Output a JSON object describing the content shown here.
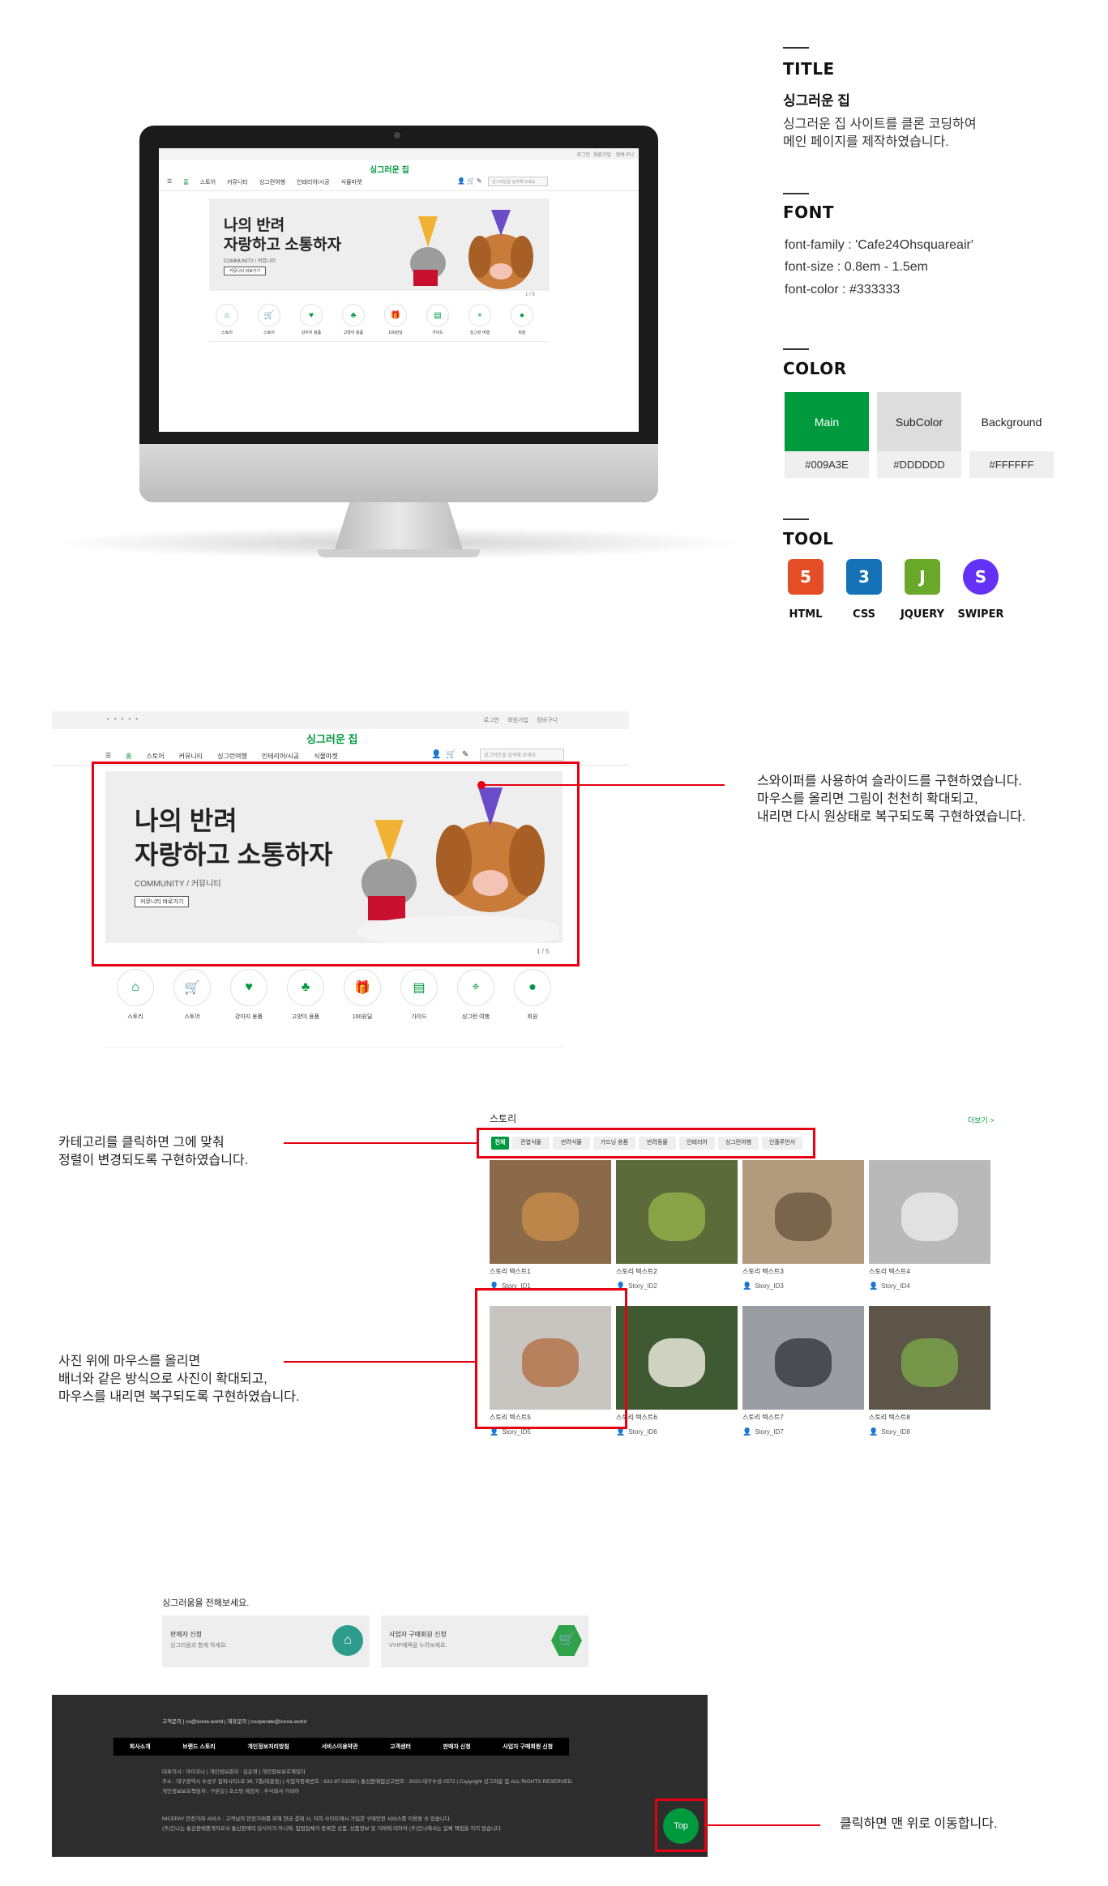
{
  "spec": {
    "title_heading": "TITLE",
    "site_name": "싱그러운 집",
    "description_1": "싱그러운 집 사이트를 클론 코딩하여",
    "description_2": "메인 페이지를 제작하였습니다.",
    "font_heading": "FONT",
    "font_family": "font-family : 'Cafe24Ohsquareair'",
    "font_size": "font-size : 0.8em - 1.5em",
    "font_color": "font-color : #333333",
    "color_heading": "COLOR",
    "colors": [
      {
        "name": "Main",
        "hex": "#009A3E",
        "code": "#009A3E"
      },
      {
        "name": "SubColor",
        "hex": "#DDDDDD",
        "code": "#DDDDDD"
      },
      {
        "name": "Background",
        "hex": "#FFFFFF",
        "code": "#FFFFFF"
      }
    ],
    "tool_heading": "TOOL",
    "tools": [
      {
        "name": "HTML",
        "glyph": "5",
        "color": "#e44d26",
        "icon": "html5-icon"
      },
      {
        "name": "CSS",
        "glyph": "3",
        "color": "#1572b6",
        "icon": "css3-icon"
      },
      {
        "name": "JQUERY",
        "glyph": "J",
        "color": "#6aa82a",
        "icon": "jquery-icon"
      },
      {
        "name": "SWIPER",
        "glyph": "S",
        "color": "#6332f6",
        "icon": "swiper-icon"
      }
    ]
  },
  "site": {
    "logo": "싱그러운 집",
    "top_links": [
      "로그인",
      "회원가입",
      "장바구니"
    ],
    "nav": [
      "홈",
      "스토어",
      "커뮤니티",
      "싱그런여행",
      "인테리어/시공",
      "식물마켓"
    ],
    "search_placeholder": "싱그러운을 검색해 보세요",
    "banner_title_1": "나의 반려",
    "banner_title_2": "자랑하고 소통하자",
    "banner_sub": "COMMUNITY / 커뮤니티",
    "banner_button": "커뮤니티 바로가기",
    "pagination": "1 / 5",
    "categories": [
      {
        "label": "스토리",
        "icon": "home-icon"
      },
      {
        "label": "스토어",
        "icon": "cart-icon"
      },
      {
        "label": "강아지 용품",
        "icon": "dog-icon"
      },
      {
        "label": "고양이 용품",
        "icon": "cat-icon"
      },
      {
        "label": "100원딜",
        "icon": "gift-icon"
      },
      {
        "label": "가이드",
        "icon": "book-icon"
      },
      {
        "label": "싱그런 여행",
        "icon": "map-pin-icon"
      },
      {
        "label": "회원",
        "icon": "coin-icon"
      }
    ]
  },
  "annotations": {
    "swiper_1": "스와이퍼를 사용하여 슬라이드를 구현하였습니다.",
    "swiper_2": "마우스를 올리면 그림이 천천히 확대되고,",
    "swiper_3": "내리면 다시 원상태로 복구되도록 구현하였습니다.",
    "category_1": "카테고리를 클릭하면 그에 맞춰",
    "category_2": "정렬이 변경되도록 구현하였습니다.",
    "photo_1": "사진 위에 마우스를 올리면",
    "photo_2": "배너와 같은 방식으로 사진이 확대되고,",
    "photo_3": "마우스를 내리면 복구되도록 구현하였습니다.",
    "top_1": "클릭하면 맨 위로 이동합니다."
  },
  "story": {
    "heading": "스토리",
    "more": "더보기 >",
    "filters": [
      "전체",
      "관엽식물",
      "반려식물",
      "가드닝 용품",
      "반려동물",
      "인테리어",
      "싱그런여행",
      "인플루언서"
    ],
    "items": [
      {
        "title": "스토리 텍스트1",
        "user": "Story_ID1",
        "bg": "#8a6a48",
        "accent": "#c48a4a"
      },
      {
        "title": "스토리 텍스트2",
        "user": "Story_ID2",
        "bg": "#5d6b3a",
        "accent": "#8fae4a"
      },
      {
        "title": "스토리 텍스트3",
        "user": "Story_ID3",
        "bg": "#b29a7c",
        "accent": "#6e5a44"
      },
      {
        "title": "스토리 텍스트4",
        "user": "Story_ID4",
        "bg": "#b9b9b9",
        "accent": "#e8e8e8"
      },
      {
        "title": "스토리 텍스트5",
        "user": "Story_ID5",
        "bg": "#c8c4c0",
        "accent": "#b5754b"
      },
      {
        "title": "스토리 텍스트6",
        "user": "Story_ID6",
        "bg": "#3f5a33",
        "accent": "#e9e8da"
      },
      {
        "title": "스토리 텍스트7",
        "user": "Story_ID7",
        "bg": "#9a9da4",
        "accent": "#3b3e44"
      },
      {
        "title": "스토리 텍스트8",
        "user": "Story_ID8",
        "bg": "#5d5648",
        "accent": "#79a04a"
      }
    ]
  },
  "contact": {
    "heading": "싱그러움을 전해보세요.",
    "card1_title": "판매자 신청",
    "card1_sub": "싱그러움과 함께 하세요.",
    "card2_title": "사업자 구매회원 신청",
    "card2_sub": "VVIP혜택을 누려보세요."
  },
  "footer": {
    "contact_line": "고객문의 | cs@icona.world | 제휴문의 | cooperate@icona.world",
    "nav": [
      "회사소개",
      "브랜드 스토리",
      "개인정보처리방침",
      "서비스이용약관",
      "고객센터",
      "판매자 신청",
      "사업자 구매회원 신청"
    ],
    "info_1": "대표이사 : 아이코나 | 개인정보관리 : 김은영 | 개인정보보호책임자",
    "info_2": "주소 : 대구광역시 수성구 알파시티1로 39, 7층(대흥동) | 사업자등록번호 : 632-87-01550 | 통신판매업신고번호 : 2020-대구수성-0572 | Copyright 싱그러운 집 ALL RIGHTS RESERVED.",
    "info_3": "개인정보보호책임자 : 구본길 | 호스팅 제공자 : 주식회사 가비아",
    "legal_1": "NICEPAY 안전거래 서비스 : 고객님의 안전거래를 위해 현금 결제 시, 저희 사이트에서 가입한 구매안전 서비스를 이용할 수 있습니다.",
    "legal_2": "(주)인나는 통신판매중개자로서 통신판매의 당사자가 아니며, 입점업체가 등록한 상품, 상품정보 및 거래에 대하여 (주)인나에서는 일체 책임을 지지 않습니다.",
    "top_button": "Top"
  }
}
